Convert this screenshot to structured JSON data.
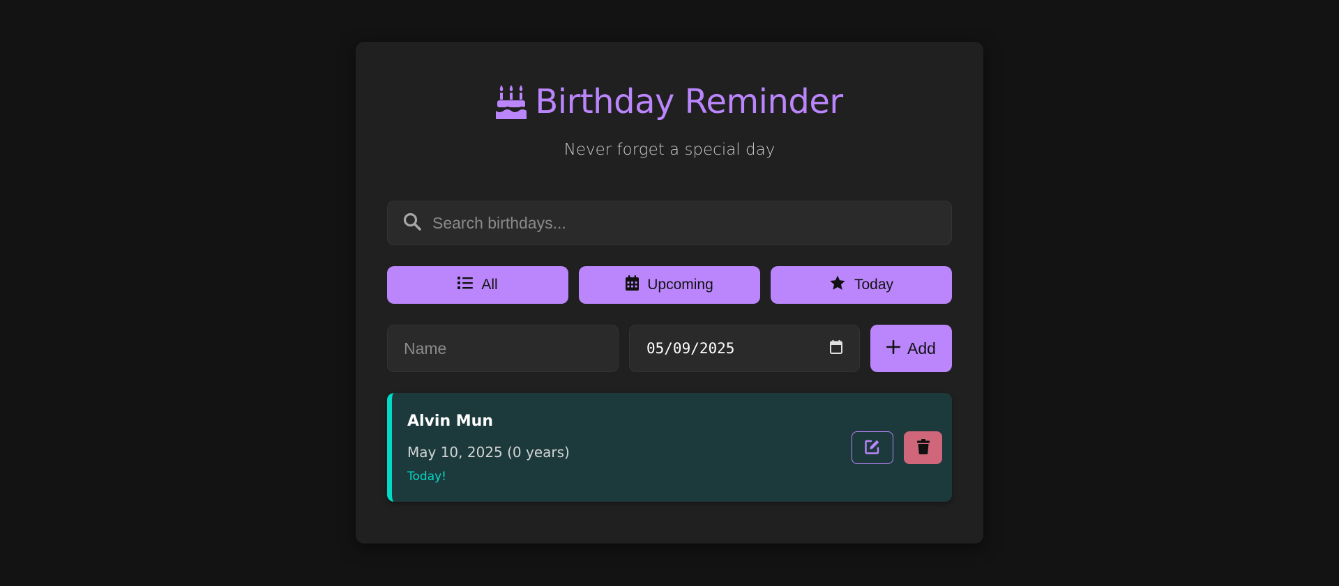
{
  "header": {
    "title": "Birthday Reminder",
    "subtitle": "Never forget a special day",
    "icon": "birthday-cake-icon"
  },
  "search": {
    "placeholder": "Search birthdays...",
    "value": "",
    "icon": "search-icon"
  },
  "filters": [
    {
      "label": "All",
      "icon": "list-icon"
    },
    {
      "label": "Upcoming",
      "icon": "calendar-icon"
    },
    {
      "label": "Today",
      "icon": "star-icon"
    }
  ],
  "form": {
    "name_placeholder": "Name",
    "name_value": "",
    "date_value": "05/09/2025",
    "add_label": "Add"
  },
  "birthdays": [
    {
      "name": "Alvin Mun",
      "date": "May 10, 2025 (0 years)",
      "status": "Today!"
    }
  ],
  "colors": {
    "accent": "#bb86fc",
    "teal": "#03dac6",
    "danger": "#cf6679",
    "card_bg": "#202020",
    "page_bg": "#131313",
    "item_bg": "#1c3a3c"
  }
}
